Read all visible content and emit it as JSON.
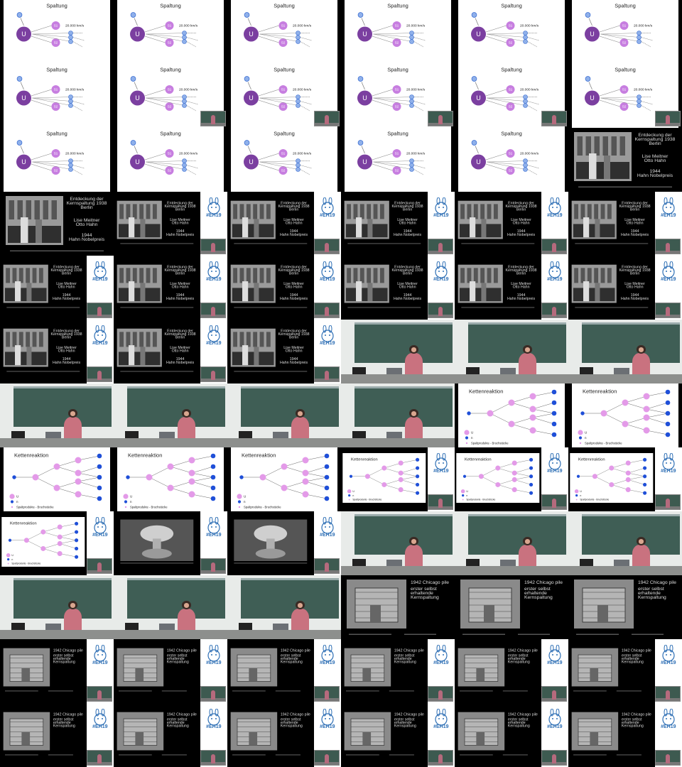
{
  "grid": {
    "columns": 6,
    "rows": 11
  },
  "slide_texts": {
    "spaltung": {
      "title": "Spaltung",
      "nucleus_label": "U",
      "fragment_1": "S1",
      "fragment_2": "S2",
      "speed": "20.000 km/s"
    },
    "kettenreaktion": {
      "title": "Kettenreaktion",
      "legend_u": "U",
      "legend_n": "n",
      "legend_products": "Spaltprodukte - Bruchstücke"
    },
    "entdeckung": {
      "heading": [
        "Entdeckung der",
        "Kernspaltung 1938",
        "Berlin"
      ],
      "names_1": [
        "Lise Meitner",
        "Otto Hahn"
      ],
      "names_2": [
        "1944",
        "Hahn Nobelpreis"
      ]
    },
    "chicago": {
      "lines": [
        "1942 Chicago pile",
        "erster selbst",
        "erhaltende",
        "Kernspaltung"
      ]
    },
    "sidebar": {
      "hashtag": "#EH19"
    }
  },
  "colors": {
    "purple_large": "#7b3fa0",
    "purple_light": "#c77ee0",
    "blue_node": "#3c6fd3",
    "blue_light": "#8fb0ea",
    "chain_pink": "#e39ae8",
    "chain_blue": "#1f4fd8",
    "board": "#3f5e55",
    "logo_blue": "#2e6fb5"
  },
  "tiles": [
    {
      "kind": "spaltung",
      "layout": "full",
      "pip": false
    },
    {
      "kind": "spaltung",
      "layout": "full",
      "pip": false
    },
    {
      "kind": "spaltung",
      "layout": "full",
      "pip": false
    },
    {
      "kind": "spaltung",
      "layout": "full",
      "pip": false
    },
    {
      "kind": "spaltung",
      "layout": "full",
      "pip": false
    },
    {
      "kind": "spaltung",
      "layout": "full",
      "pip": false
    },
    {
      "kind": "spaltung",
      "layout": "full",
      "pip": false
    },
    {
      "kind": "spaltung",
      "layout": "full",
      "pip": true
    },
    {
      "kind": "spaltung",
      "layout": "full",
      "pip": true
    },
    {
      "kind": "spaltung",
      "layout": "full",
      "pip": true
    },
    {
      "kind": "spaltung",
      "layout": "full",
      "pip": true
    },
    {
      "kind": "spaltung",
      "layout": "full",
      "pip": true
    },
    {
      "kind": "spaltung",
      "layout": "full",
      "pip": false
    },
    {
      "kind": "spaltung",
      "layout": "full",
      "pip": false
    },
    {
      "kind": "spaltung",
      "layout": "full",
      "pip": false
    },
    {
      "kind": "spaltung",
      "layout": "full",
      "pip": false
    },
    {
      "kind": "spaltung",
      "layout": "full",
      "pip": false
    },
    {
      "kind": "entdeckung",
      "layout": "full",
      "pip": false
    },
    {
      "kind": "entdeckung",
      "layout": "full",
      "pip": false
    },
    {
      "kind": "entdeckung",
      "layout": "side",
      "pip": true
    },
    {
      "kind": "entdeckung",
      "layout": "side",
      "pip": true
    },
    {
      "kind": "entdeckung",
      "layout": "side",
      "pip": true
    },
    {
      "kind": "entdeckung",
      "layout": "side",
      "pip": true
    },
    {
      "kind": "entdeckung",
      "layout": "side",
      "pip": true
    },
    {
      "kind": "entdeckung",
      "layout": "side",
      "pip": true
    },
    {
      "kind": "entdeckung",
      "layout": "side",
      "pip": true
    },
    {
      "kind": "entdeckung",
      "layout": "side",
      "pip": true
    },
    {
      "kind": "entdeckung",
      "layout": "side",
      "pip": true
    },
    {
      "kind": "entdeckung",
      "layout": "side",
      "pip": true
    },
    {
      "kind": "entdeckung",
      "layout": "side",
      "pip": true
    },
    {
      "kind": "entdeckung",
      "layout": "side",
      "pip": true
    },
    {
      "kind": "entdeckung",
      "layout": "side",
      "pip": true
    },
    {
      "kind": "entdeckung",
      "layout": "side",
      "pip": true
    },
    {
      "kind": "camera",
      "layout": "full",
      "pip": false
    },
    {
      "kind": "camera",
      "layout": "full",
      "pip": false
    },
    {
      "kind": "camera",
      "layout": "full",
      "pip": false
    },
    {
      "kind": "camera",
      "layout": "full",
      "pip": false
    },
    {
      "kind": "camera",
      "layout": "full",
      "pip": false
    },
    {
      "kind": "camera",
      "layout": "full",
      "pip": false
    },
    {
      "kind": "camera",
      "layout": "full",
      "pip": false
    },
    {
      "kind": "ketten",
      "layout": "full",
      "pip": false
    },
    {
      "kind": "ketten",
      "layout": "full",
      "pip": false
    },
    {
      "kind": "ketten",
      "layout": "full",
      "pip": false
    },
    {
      "kind": "ketten",
      "layout": "full",
      "pip": false
    },
    {
      "kind": "ketten",
      "layout": "full",
      "pip": false
    },
    {
      "kind": "ketten",
      "layout": "side",
      "pip": true
    },
    {
      "kind": "ketten",
      "layout": "side",
      "pip": true
    },
    {
      "kind": "ketten",
      "layout": "side",
      "pip": true
    },
    {
      "kind": "ketten",
      "layout": "side",
      "pip": true
    },
    {
      "kind": "bomb",
      "layout": "side",
      "pip": true
    },
    {
      "kind": "bomb",
      "layout": "side",
      "pip": true
    },
    {
      "kind": "camera",
      "layout": "full",
      "pip": false
    },
    {
      "kind": "camera",
      "layout": "full",
      "pip": false
    },
    {
      "kind": "camera",
      "layout": "full",
      "pip": false
    },
    {
      "kind": "camera",
      "layout": "full",
      "pip": false
    },
    {
      "kind": "camera",
      "layout": "full",
      "pip": false
    },
    {
      "kind": "camera",
      "layout": "full",
      "pip": false
    },
    {
      "kind": "chicago",
      "layout": "full",
      "pip": false
    },
    {
      "kind": "chicago",
      "layout": "full",
      "pip": false
    },
    {
      "kind": "chicago",
      "layout": "full",
      "pip": false
    },
    {
      "kind": "chicago",
      "layout": "side",
      "pip": true
    },
    {
      "kind": "chicago",
      "layout": "side",
      "pip": true
    },
    {
      "kind": "chicago",
      "layout": "side",
      "pip": true
    },
    {
      "kind": "chicago",
      "layout": "side",
      "pip": true
    },
    {
      "kind": "chicago",
      "layout": "side",
      "pip": true
    },
    {
      "kind": "chicago",
      "layout": "side",
      "pip": true
    },
    {
      "kind": "chicago",
      "layout": "side",
      "pip": true
    },
    {
      "kind": "chicago",
      "layout": "side",
      "pip": true
    },
    {
      "kind": "chicago",
      "layout": "side",
      "pip": true
    },
    {
      "kind": "chicago",
      "layout": "side",
      "pip": true
    },
    {
      "kind": "chicago",
      "layout": "side",
      "pip": true
    },
    {
      "kind": "chicago",
      "layout": "side",
      "pip": true
    }
  ]
}
